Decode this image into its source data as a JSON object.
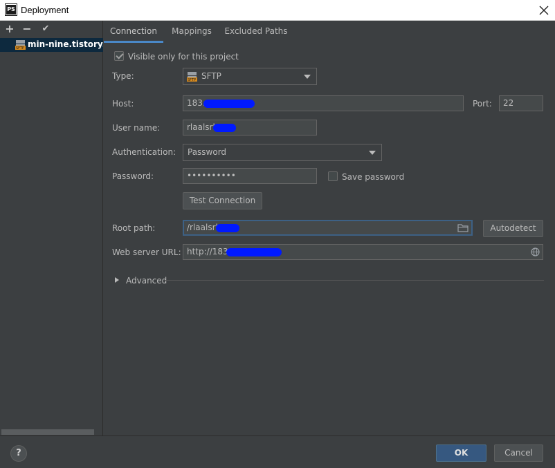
{
  "window": {
    "title": "Deployment",
    "app_icon_text": "PS"
  },
  "toolbar": {
    "add": "+",
    "remove": "−",
    "apply": "✔"
  },
  "servers": [
    {
      "name": "min-nine.tistory.com"
    }
  ],
  "tabs": [
    {
      "label": "Connection",
      "active": true
    },
    {
      "label": "Mappings",
      "active": false
    },
    {
      "label": "Excluded Paths",
      "active": false
    }
  ],
  "form": {
    "visible_only": {
      "label": "Visible only for this project",
      "checked": true
    },
    "type": {
      "label": "Type:",
      "value": "SFTP",
      "icon": "sftp-icon"
    },
    "host": {
      "label": "Host:",
      "value": "183."
    },
    "port": {
      "label": "Port:",
      "value": "22"
    },
    "username": {
      "label": "User name:",
      "value": "rlaalsrb"
    },
    "auth": {
      "label": "Authentication:",
      "value": "Password"
    },
    "password": {
      "label": "Password:",
      "value": "••••••••••"
    },
    "save_password": {
      "label": "Save password",
      "checked": false
    },
    "test_connection": "Test Connection",
    "root_path": {
      "label": "Root path:",
      "value": "/rlaalsrb"
    },
    "autodetect": "Autodetect",
    "web_url": {
      "label": "Web server URL:",
      "value": "http://183."
    },
    "advanced": "Advanced"
  },
  "footer": {
    "help": "?",
    "ok": "OK",
    "cancel": "Cancel"
  },
  "colors": {
    "accent": "#4a88c7",
    "selection": "#0d293e",
    "redaction": "#0019ff",
    "background": "#3c3f41"
  }
}
